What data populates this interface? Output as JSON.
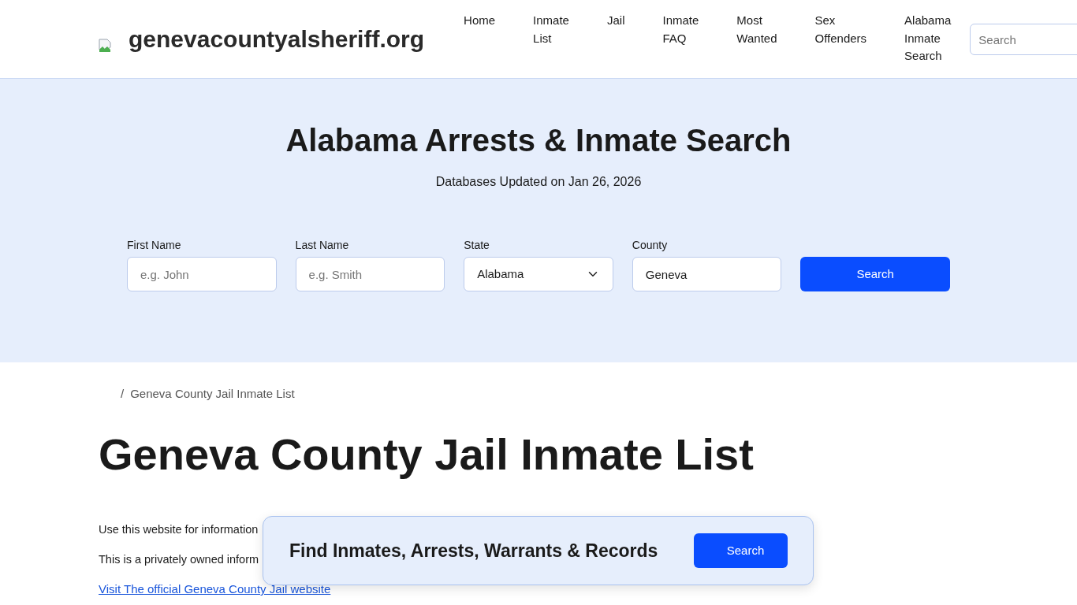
{
  "header": {
    "logo_text": "genevacountyalsheriff.org",
    "nav": [
      "Home",
      "Inmate List",
      "Jail",
      "Inmate FAQ",
      "Most Wanted",
      "Sex Offenders",
      "Alabama Inmate Search"
    ],
    "search": {
      "placeholder": "Search"
    }
  },
  "hero": {
    "title": "Alabama Arrests & Inmate Search",
    "subtitle": "Databases Updated on Jan 26, 2026",
    "fields": [
      {
        "kind": "text",
        "label": "First Name",
        "placeholder": "e.g. John"
      },
      {
        "kind": "text",
        "label": "Last Name",
        "placeholder": "e.g. Smith"
      },
      {
        "kind": "select",
        "label": "State",
        "value": "Alabama"
      },
      {
        "kind": "text",
        "label": "County",
        "value": "Geneva"
      }
    ],
    "button": "Search"
  },
  "breadcrumb": {
    "separator": "/",
    "current": "Geneva County Jail Inmate List"
  },
  "page_title": "Geneva County Jail Inmate List",
  "paragraphs": [
    "Use this website for information",
    "This is a privately owned inform"
  ],
  "link": "Visit The official Geneva County Jail website",
  "banner": {
    "text": "Find Inmates, Arrests, Warrants & Records",
    "button": "Search"
  }
}
